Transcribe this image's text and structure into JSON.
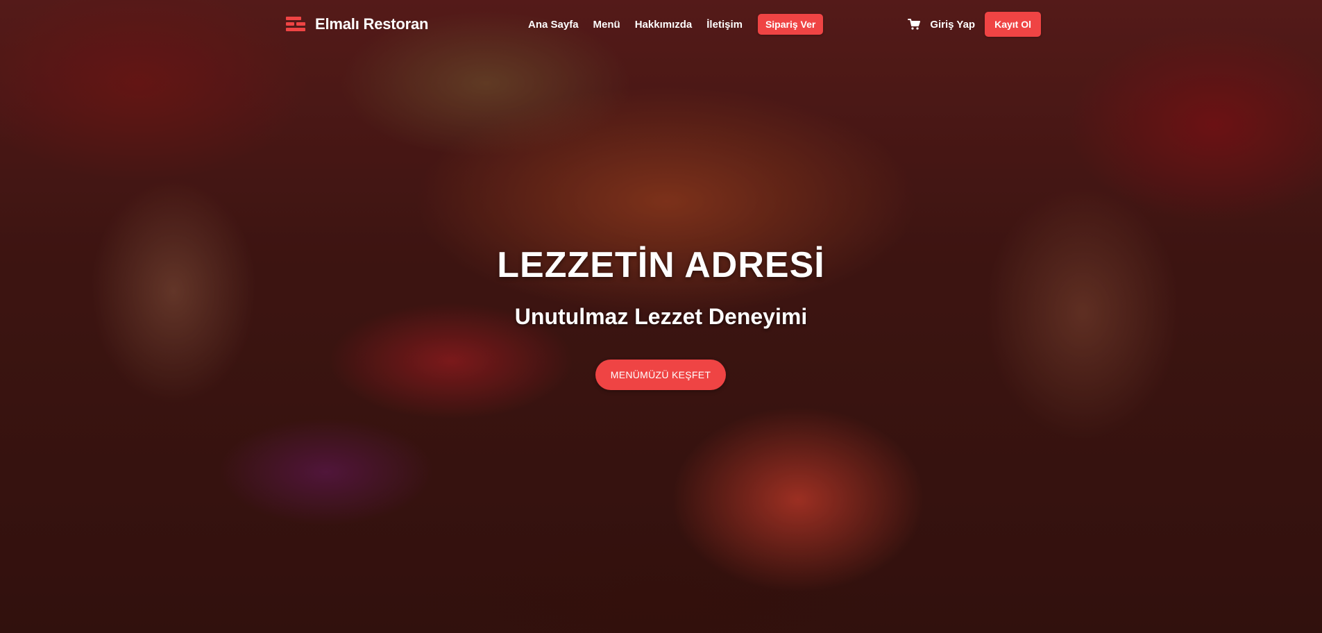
{
  "colors": {
    "accent": "#ef4444",
    "text": "#ffffff"
  },
  "navbar": {
    "brand": {
      "logo_icon": "restaurant-logo-icon",
      "name": "Elmalı Restoran"
    },
    "links": [
      {
        "label": "Ana Sayfa"
      },
      {
        "label": "Menü"
      },
      {
        "label": "Hakkımızda"
      },
      {
        "label": "İletişim"
      }
    ],
    "order_button": "Sipariş Ver",
    "cart_icon": "shopping-cart-icon",
    "login": "Giriş Yap",
    "register": "Kayıt Ol"
  },
  "hero": {
    "title": "LEZZETİN ADRESİ",
    "subtitle": "Unutulmaz Lezzet Deneyimi",
    "cta": "MENÜMÜZÜ KEŞFET"
  }
}
